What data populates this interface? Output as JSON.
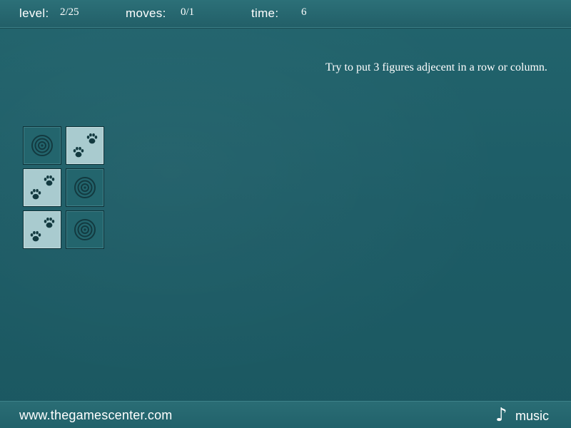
{
  "status_bar": {
    "level_label": "level:",
    "level_value": "2/25",
    "moves_label": "moves:",
    "moves_value": "0/1",
    "time_label": "time:",
    "time_value": "6"
  },
  "instruction": "Try to put 3 figures adjecent in a row or column.",
  "board": {
    "rows": 3,
    "cols": 2,
    "tiles": [
      [
        "target",
        "paw"
      ],
      [
        "paw",
        "target"
      ],
      [
        "paw",
        "target"
      ]
    ],
    "icon_names": {
      "target": "target-icon",
      "paw": "paw-print-icon"
    }
  },
  "footer": {
    "site": "www.thegamescenter.com",
    "music_label": "music",
    "music_icon": "music-note-icon"
  },
  "colors": {
    "background": "#1f5c66",
    "tile_dark": "#23656d",
    "tile_light": "#a9cbcf",
    "icon_dark": "#133a40",
    "text": "#ffffff"
  }
}
